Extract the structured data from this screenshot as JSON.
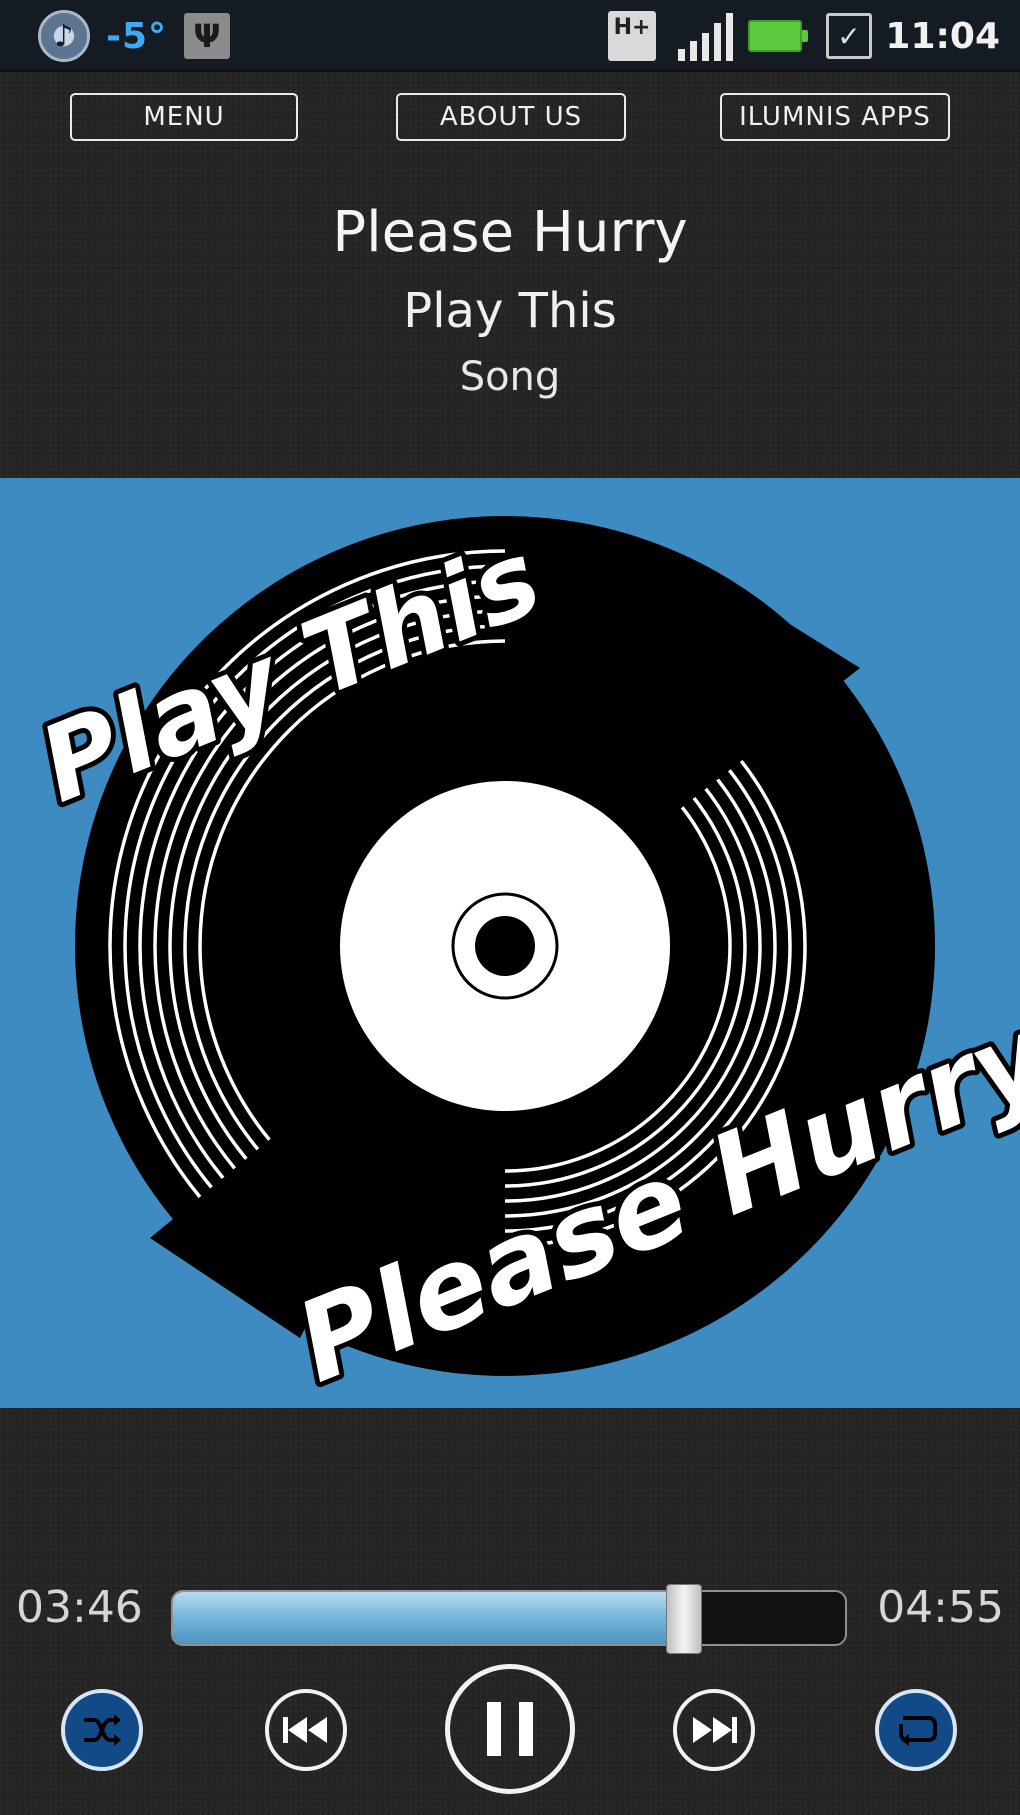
{
  "status_bar": {
    "temperature": "-5°",
    "time": "11:04",
    "network": "H+",
    "icons": [
      "music-icon",
      "usb-icon",
      "hplus-icon",
      "signal-icon",
      "battery-icon",
      "checkbox-icon"
    ],
    "colors": {
      "temperature": "#3fa9f5",
      "battery": "#5cc83e"
    }
  },
  "nav": {
    "menu": "MENU",
    "about": "ABOUT US",
    "apps": "ILUMNIS APPS"
  },
  "track": {
    "title": "Please Hurry",
    "artist": "Play This",
    "album": "Song"
  },
  "album_art": {
    "text_top": "Play This",
    "text_bottom": "Please Hurry",
    "background": "#3d8bc1"
  },
  "player": {
    "current_time": "03:46",
    "total_time": "04:55",
    "progress": 0.76,
    "controls": [
      "shuffle-icon",
      "previous-icon",
      "pause-icon",
      "next-icon",
      "repeat-icon"
    ],
    "accent": "#114a86"
  }
}
